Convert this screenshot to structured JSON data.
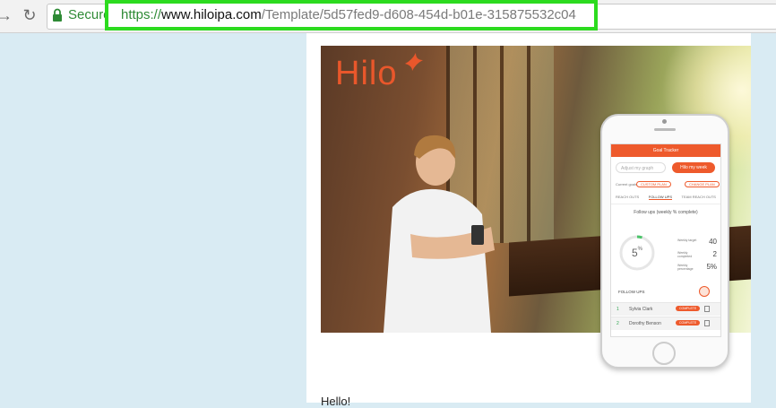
{
  "browser": {
    "secure_label": "Secure",
    "url_scheme": "https://",
    "url_domain": "www.hiloipa.com",
    "url_path": "/Template/5d57fed9-d608-454d-b01e-315875532c04",
    "highlight_color": "#2cdb1f"
  },
  "email": {
    "brand_logo": "Hilo",
    "brand_color": "#e9572b",
    "greeting": "Hello!"
  },
  "phone_app": {
    "header": "Goal Tracker",
    "select_placeholder": "Adjust my graph",
    "cta": "Hilo my week",
    "row_label": "Current goals",
    "pill_a": "CUSTOM PLAN",
    "pill_b": "CHANGE PLAN",
    "tabs": [
      "REACH OUTS",
      "FOLLOW UPS",
      "TEAM REACH OUTS"
    ],
    "active_tab": "FOLLOW UPS",
    "progress_title": "Follow ups (weekly % complete)",
    "progress_value": "5",
    "progress_unit": "%",
    "progress_fraction": 0.05,
    "stats": [
      {
        "label": "Weekly target",
        "value": "40"
      },
      {
        "label": "Weekly completed",
        "value": "2"
      },
      {
        "label": "Weekly percentage",
        "value": "5%"
      }
    ],
    "followups_heading": "FOLLOW UPS",
    "followups": [
      {
        "num": "1",
        "name": "Sylvia Clark",
        "action": "COMPLETE"
      },
      {
        "num": "2",
        "name": "Dorothy Benson",
        "action": "COMPLETE"
      }
    ]
  }
}
